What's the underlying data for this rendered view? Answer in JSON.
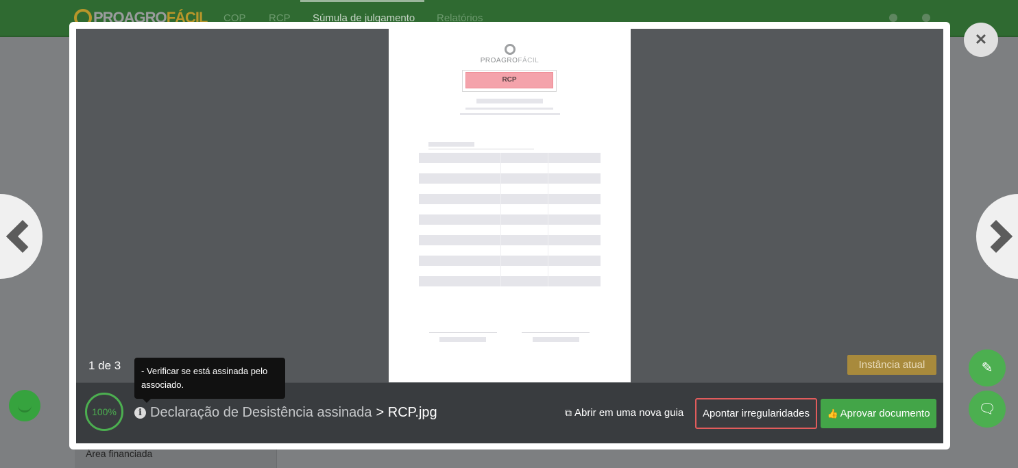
{
  "app": {
    "logo_plain": "PROAGRO",
    "logo_accent": "FÁCIL",
    "nav": [
      "COP",
      "RCP",
      "Súmula de julgamento",
      "Relatórios"
    ],
    "active_nav": "Súmula de julgamento"
  },
  "side_panel": {
    "label": "Área financiada"
  },
  "viewer": {
    "page_counter": "1 de 3",
    "instance_badge": "Instância atual",
    "document_preview": {
      "logo_plain": "PROAGRO",
      "logo_accent": "FÁCIL",
      "stamp": "RCP"
    }
  },
  "tooltip": {
    "text": "- Verificar se está assinada pelo associado."
  },
  "footer": {
    "progress": "100%",
    "doc_type": "Declaração de Desistência assinada",
    "separator": " > ",
    "file_name": "RCP.jpg",
    "open_link": "Abrir em uma nova guia",
    "irregular_button": "Apontar irregularidades",
    "approve_button": "Aprovar documento"
  },
  "icons": {
    "close": "close-icon",
    "prev": "chevron-left-icon",
    "next": "chevron-right-icon",
    "edit": "edit-icon",
    "chat": "chat-icon",
    "info": "info-icon",
    "external": "external-link-icon",
    "thumbs_up": "thumbs-up-icon"
  },
  "colors": {
    "topbar": "#2f6a31",
    "accent_green": "#4caf50",
    "danger": "#e25c5c",
    "badge": "#a88a3c",
    "stamp": "#f4a3ab"
  }
}
